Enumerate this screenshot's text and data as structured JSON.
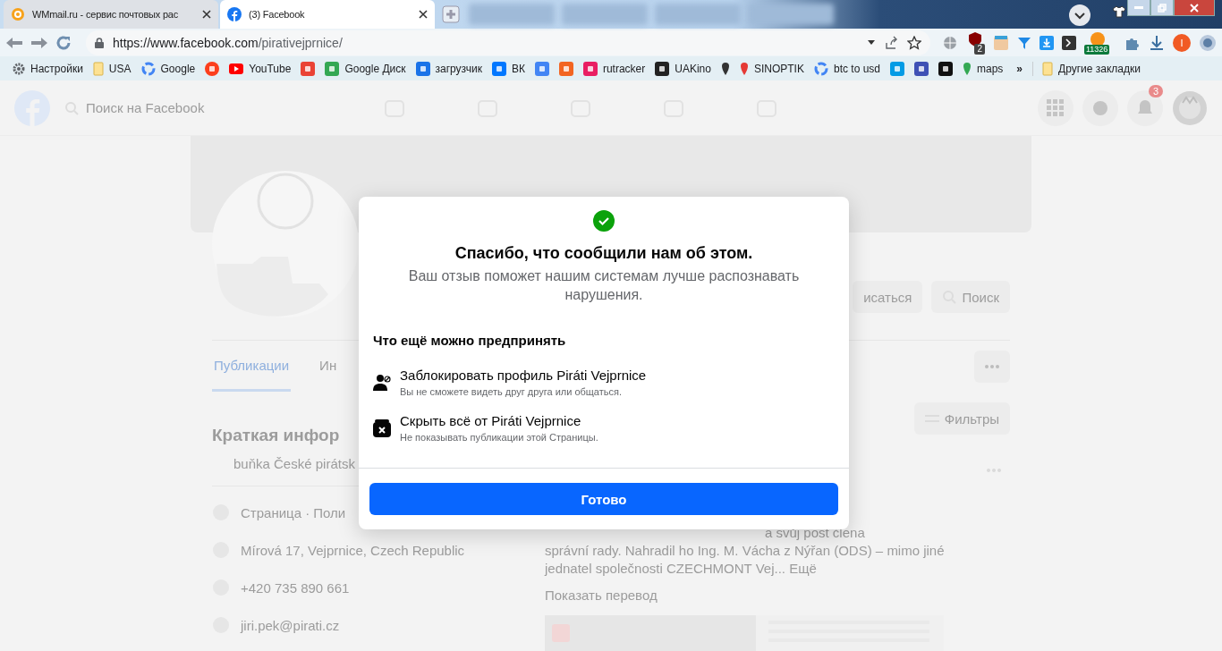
{
  "browser": {
    "tabs": [
      {
        "title": "WMmail.ru - сервис почтовых рас",
        "selected": false
      },
      {
        "title": "(3) Facebook",
        "selected": true
      }
    ],
    "url": {
      "host": "https://www.facebook.com",
      "path": "/pirativejprnice/"
    },
    "extension_badges": {
      "ublock": "2",
      "bitcoin": "11326",
      "profile": "I"
    },
    "bookmarks": [
      {
        "kind": "link",
        "label": "Настройки"
      },
      {
        "kind": "link",
        "label": "USA"
      },
      {
        "kind": "link",
        "label": "Google"
      },
      {
        "kind": "icon"
      },
      {
        "kind": "link",
        "label": "YouTube"
      },
      {
        "kind": "icon"
      },
      {
        "kind": "link",
        "label": "Google Диск"
      },
      {
        "kind": "link",
        "label": "загрузчик"
      },
      {
        "kind": "link",
        "label": "ВК"
      },
      {
        "kind": "icon"
      },
      {
        "kind": "icon"
      },
      {
        "kind": "link",
        "label": "rutracker"
      },
      {
        "kind": "link",
        "label": "UAKino"
      },
      {
        "kind": "icon"
      },
      {
        "kind": "link",
        "label": "SINOPTIK"
      },
      {
        "kind": "link",
        "label": "btc to usd"
      },
      {
        "kind": "icon"
      },
      {
        "kind": "icon"
      },
      {
        "kind": "icon"
      },
      {
        "kind": "link",
        "label": "maps"
      }
    ],
    "more_bookmarks": "»",
    "other_bookmarks": "Другие закладки"
  },
  "facebook": {
    "search_placeholder": "Поиск на Facebook",
    "notification_count": "3",
    "actions": [
      {
        "label": "исаться"
      },
      {
        "label": "Поиск"
      }
    ],
    "tabs": [
      {
        "label": "Публикации",
        "selected": true
      },
      {
        "label": "Ин",
        "selected": false
      }
    ],
    "intro": {
      "title": "Краткая инфор",
      "subtitle": "buňka České pirátsk",
      "items": [
        "Страница · Поли",
        "Mírová 17, Vejprnice, Czech Republic",
        "+420 735 890 661",
        "jiri.pek@pirati.cz"
      ]
    },
    "filters": "Фильтры",
    "post": {
      "lines": [
        "a svůj post člena",
        "správní rady. Nahradil ho Ing. M. Vácha z Nýřan (ODS) – mimo jiné",
        "jednatel společnosti CZECHMONT Vej... Ещё"
      ],
      "translate": "Показать перевод"
    }
  },
  "dialog": {
    "title": "Спасибо, что сообщили нам об этом.",
    "subtitle": "Ваш отзыв поможет нашим системам лучше распознавать нарушения.",
    "section": "Что ещё можно предпринять",
    "options": [
      {
        "kind": "block",
        "title": "Заблокировать профиль Piráti Vejprnice",
        "description": "Вы не сможете видеть друг друга или общаться."
      },
      {
        "kind": "hide",
        "title": "Скрыть всё от Piráti Vejprnice",
        "description": "Не показывать публикации этой Страницы."
      }
    ],
    "button": "Готово"
  }
}
